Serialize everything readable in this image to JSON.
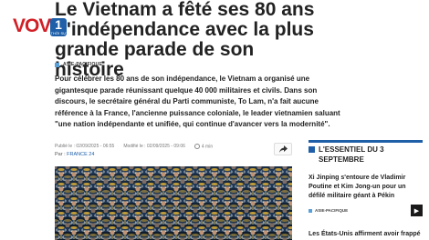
{
  "logo": {
    "text": "VOV",
    "box_number": "1",
    "box_sub": "THỜI SỰ"
  },
  "article": {
    "title": "Le Vietnam a fêté ses 80 ans d'indépendance avec la plus grande parade de son histoire",
    "category": "ASIE-PACIFIQUE",
    "lead": "Pour célébrer les 80 ans de son indépendance, le Vietnam a organisé une gigantesque parade réunissant quelque 40 000 militaires et civils. Dans son discours, le secrétaire général du Parti communiste, To Lam, n'a fait aucune référence à la France, l'ancienne puissance coloniale, le leader vietnamien saluant \"une nation indépendante et unifiée, qui continue d'avancer vers la modernité\".",
    "published": "Publié le : 02/09/2025 - 06:55",
    "modified": "Modifié le : 02/09/2025 - 09:06",
    "read_time": "4 min",
    "author_prefix": "Par : ",
    "author": "FRANCE 24",
    "share_icon": "share-icon"
  },
  "sidebar": {
    "title": "L'ESSENTIEL DU 3 SEPTEMBRE",
    "items": [
      {
        "text": "Xi Jinping s'entoure de Vladimir Poutine et Kim Jong-un pour un défilé militaire géant à Pékin",
        "category": "ASIE-PACIFIQUE",
        "arrow_icon": "arrow-right-icon"
      },
      {
        "text": "Les États-Unis affirment avoir frappé"
      }
    ]
  },
  "colors": {
    "accent": "#1e5fa8",
    "brand_red": "#d11f26",
    "category_blue": "#5aa0d8"
  }
}
